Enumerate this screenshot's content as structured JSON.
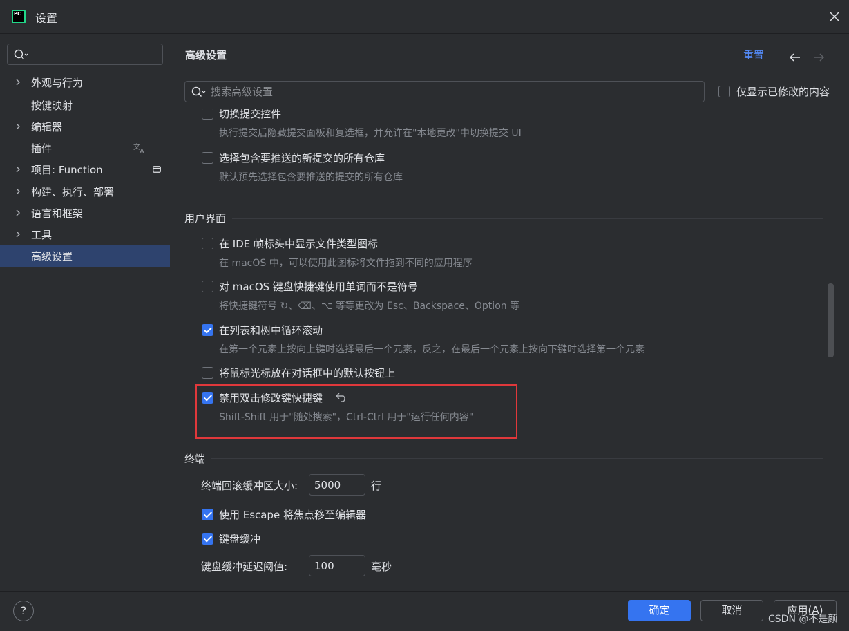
{
  "window": {
    "title": "设置",
    "logo_text": "PC"
  },
  "sidebar": {
    "search_placeholder": "",
    "items": [
      {
        "label": "外观与行为",
        "expandable": true
      },
      {
        "label": "按键映射",
        "expandable": false
      },
      {
        "label": "编辑器",
        "expandable": true
      },
      {
        "label": "插件",
        "expandable": false
      },
      {
        "label": "项目: Function",
        "expandable": true
      },
      {
        "label": "构建、执行、部署",
        "expandable": true
      },
      {
        "label": "语言和框架",
        "expandable": true
      },
      {
        "label": "工具",
        "expandable": true
      },
      {
        "label": "高级设置",
        "expandable": false,
        "selected": true
      }
    ]
  },
  "header": {
    "title": "高级设置",
    "reset": "重置",
    "search_placeholder": "搜索高级设置",
    "only_modified": "仅显示已修改的内容"
  },
  "vcs_options": [
    {
      "label": "切换提交控件",
      "desc": "执行提交后隐藏提交面板和复选框，并允许在\"本地更改\"中切换提交 UI",
      "checked": false
    },
    {
      "label": "选择包含要推送的新提交的所有仓库",
      "desc": "默认预先选择包含要推送的提交的所有仓库",
      "checked": false
    }
  ],
  "ui_section": {
    "title": "用户界面",
    "options": [
      {
        "label": "在 IDE 帧标头中显示文件类型图标",
        "desc": "在 macOS 中，可以使用此图标将文件拖到不同的应用程序",
        "checked": false
      },
      {
        "label": "对 macOS 键盘快捷键使用单词而不是符号",
        "desc": "将快捷键符号 ↻、⌫、⌥ 等等更改为 Esc、Backspace、Option 等",
        "checked": false
      },
      {
        "label": "在列表和树中循环滚动",
        "desc": "在第一个元素上按向上键时选择最后一个元素，反之，在最后一个元素上按向下键时选择第一个元素",
        "checked": true
      },
      {
        "label": "将鼠标光标放在对话框中的默认按钮上",
        "desc": "",
        "checked": false
      },
      {
        "label": "禁用双击修改键快捷键",
        "desc": "Shift-Shift 用于\"随处搜索\"，Ctrl-Ctrl 用于\"运行任何内容\"",
        "checked": true
      }
    ]
  },
  "terminal_section": {
    "title": "终端",
    "buffer_label": "终端回滚缓冲区大小:",
    "buffer_value": "5000",
    "buffer_unit": "行",
    "escape_label": "使用 Escape 将焦点移至编辑器",
    "escape_checked": true,
    "typeahead_label": "键盘缓冲",
    "typeahead_checked": true,
    "latency_label": "键盘缓冲延迟阈值:",
    "latency_value": "100",
    "latency_unit": "毫秒"
  },
  "footer": {
    "help": "?",
    "ok": "确定",
    "cancel": "取消",
    "apply": "应用(A)",
    "watermark": "CSDN @不是颜"
  },
  "colors": {
    "accent": "#3574f0",
    "link": "#548af7",
    "highlight_box": "#e0383b",
    "selected_bg": "#2e436e"
  }
}
